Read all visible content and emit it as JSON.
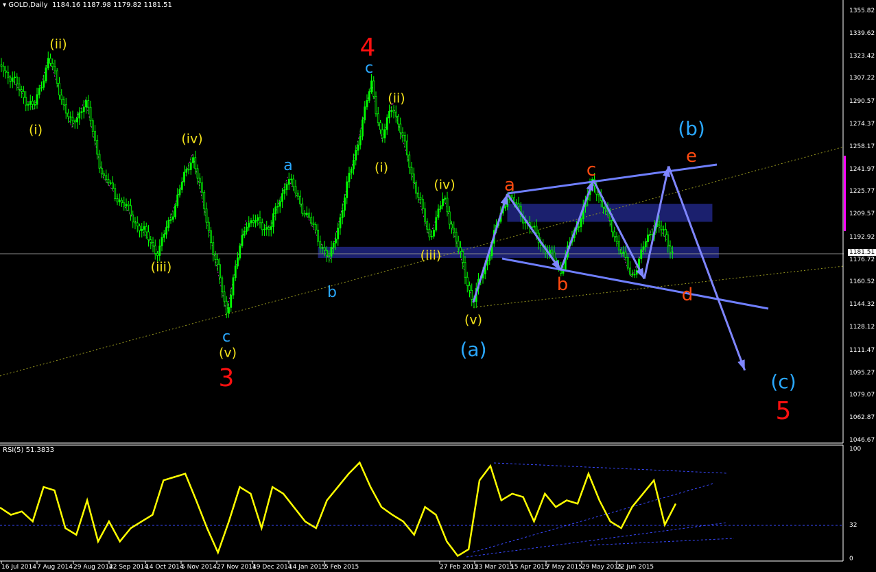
{
  "header": {
    "title": "GOLD,Daily",
    "ohlc": "1184.16 1187.98 1179.82 1181.51"
  },
  "colors": {
    "candle": "#00ff00",
    "rsi": "#ffff00",
    "channel": "#7f86ff",
    "zone": "#1e237a",
    "wave_yellow": "#f5e31a",
    "wave_cyan": "#2aa8ff",
    "wave_red": "#ff1010",
    "wave_orange": "#ff4a10"
  },
  "chart_data": [
    {
      "type": "candlestick",
      "symbol": "GOLD",
      "timeframe": "Daily",
      "ylim": [
        1046.67,
        1355.82
      ],
      "y_ticks": [
        "1355.82",
        "1339.62",
        "1323.42",
        "1307.22",
        "1290.57",
        "1274.37",
        "1258.17",
        "1241.97",
        "1225.77",
        "1209.57",
        "1192.92",
        "1176.72",
        "1160.52",
        "1144.32",
        "1128.12",
        "1111.47",
        "1095.27",
        "1079.07",
        "1062.87",
        "1046.67"
      ],
      "x_ticks": [
        "16 Jul 2014",
        "7 Aug 2014",
        "29 Aug 2014",
        "22 Sep 2014",
        "14 Oct 2014",
        "5 Nov 2014",
        "27 Nov 2014",
        "19 Dec 2014",
        "14 Jan 2015",
        "5 Feb 2015",
        "27 Feb 2015",
        "23 Mar 2015",
        "15 Apr 2015",
        "7 May 2015",
        "29 May 2015",
        "22 Jun 2015"
      ],
      "current_price": "1181.51",
      "pivots": [
        {
          "date": "16 Jul 2014",
          "price": 1317
        },
        {
          "date": "5 Aug 2014",
          "price": 1285
        },
        {
          "date": "14 Aug 2014",
          "price": 1322
        },
        {
          "date": "28 Aug 2014",
          "price": 1272
        },
        {
          "date": "6 Sep 2014",
          "price": 1292
        },
        {
          "date": "18 Sep 2014",
          "price": 1236
        },
        {
          "date": "22 Oct 2014",
          "price": 1182
        },
        {
          "date": "12 Nov 2014",
          "price": 1253
        },
        {
          "date": "3 Dec 2014",
          "price": 1139
        },
        {
          "date": "15 Dec 2014",
          "price": 1205
        },
        {
          "date": "1 Jan 2015",
          "price": 1200
        },
        {
          "date": "13 Jan 2015",
          "price": 1236
        },
        {
          "date": "6 Feb 2015",
          "price": 1176
        },
        {
          "date": "14 Feb 2015",
          "price": 1304
        },
        {
          "date": "16 Feb 2015",
          "price": 1262
        },
        {
          "date": "18 Feb 2015",
          "price": 1290
        },
        {
          "date": "25 Feb 2015",
          "price": 1193
        },
        {
          "date": "2 Mar 2015",
          "price": 1221
        },
        {
          "date": "22 Mar 2015",
          "price": 1146
        },
        {
          "date": "13 Apr 2015",
          "price": 1224
        },
        {
          "date": "16 May 2015",
          "price": 1169
        },
        {
          "date": "6 Jun 2015",
          "price": 1234
        },
        {
          "date": "1 Jul 2015",
          "price": 1164
        },
        {
          "date": "16 Jul 2015",
          "price": 1205
        },
        {
          "date": "27 Jul 2015",
          "price": 1181.51
        }
      ],
      "projection": [
        {
          "date": "22 Mar 2015",
          "price": 1146
        },
        {
          "date": "13 Apr 2015",
          "price": 1224
        },
        {
          "date": "16 May 2015",
          "price": 1169
        },
        {
          "date": "6 Jun 2015",
          "price": 1234
        },
        {
          "date": "9 Jul 2015",
          "price": 1163
        },
        {
          "date": "24 Jul 2015",
          "price": 1244
        },
        {
          "date": "9 Sep 2015",
          "price": 1097
        }
      ],
      "zones": [
        {
          "from": "13 Apr 2015",
          "to": "20 Aug 2015",
          "low": 1204,
          "high": 1217
        },
        {
          "from": "1 Feb 2015",
          "to": "24 Aug 2015",
          "low": 1178,
          "high": 1186
        }
      ]
    },
    {
      "type": "line",
      "title": "RSI(5) 51.3833",
      "ylim": [
        0,
        100
      ],
      "y_ticks": [
        "100",
        "32",
        "0"
      ],
      "level": 32,
      "values": [
        47.5,
        41,
        44,
        35,
        66,
        63,
        29,
        23,
        54,
        17,
        35,
        17,
        29,
        35,
        41,
        72,
        75,
        78,
        54,
        29,
        7,
        35,
        66,
        60,
        29,
        66,
        60,
        47.5,
        35,
        29,
        54,
        66,
        78,
        88,
        66,
        48,
        41,
        35,
        23,
        48,
        41,
        17,
        4,
        10,
        72,
        85,
        54,
        60,
        57,
        35,
        60,
        48,
        54,
        51,
        78,
        54,
        35,
        29,
        48,
        60,
        72,
        32,
        51
      ]
    }
  ],
  "wave_labels": {
    "w1": "(ii)",
    "w2": "(i)",
    "w3": "(iv)",
    "w4": "(iii)",
    "w5": "c",
    "w6": "(v)",
    "w7": "3",
    "w8": "4",
    "w9": "c",
    "w10": "(ii)",
    "w11": "(i)",
    "w12": "(iv)",
    "w13": "(iii)",
    "w14": "a",
    "w15": "b",
    "w16": "(v)",
    "w17": "(a)",
    "w18": "a",
    "w19": "b",
    "w20": "c",
    "w21": "d",
    "w22": "e",
    "w23": "(b)",
    "w24": "(c)",
    "w25": "5"
  }
}
